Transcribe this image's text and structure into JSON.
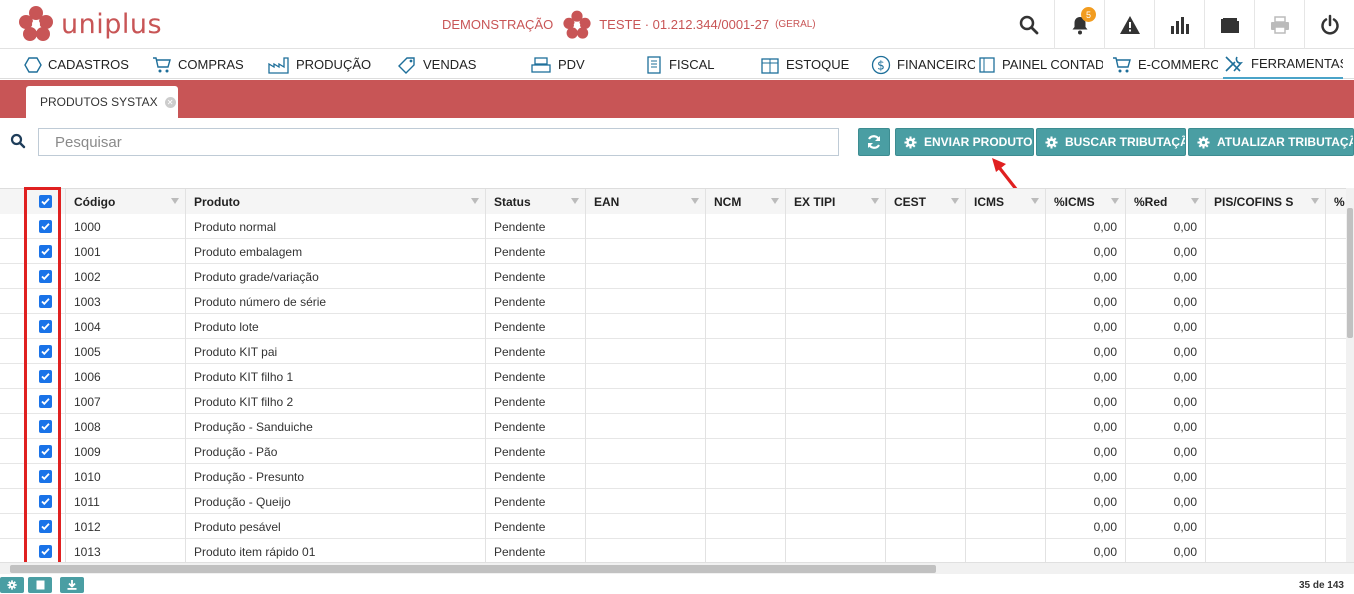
{
  "header": {
    "logo_text": "uniplus",
    "demo_label": "DEMONSTRAÇÃO",
    "company_name": "TESTE · 01.212.344/0001-27",
    "company_scope": "(GERAL)",
    "notification_count": "5",
    "icons": [
      "search-icon",
      "bell-icon",
      "warning-icon",
      "chart-icon",
      "folder-icon",
      "printer-icon",
      "power-icon"
    ]
  },
  "menu": {
    "items": [
      {
        "label": "CADASTROS",
        "icon": "hexagon-icon"
      },
      {
        "label": "COMPRAS",
        "icon": "cart-icon"
      },
      {
        "label": "PRODUÇÃO",
        "icon": "factory-icon"
      },
      {
        "label": "VENDAS",
        "icon": "tag-icon"
      },
      {
        "label": "PDV",
        "icon": "register-icon"
      },
      {
        "label": "FISCAL",
        "icon": "document-icon"
      },
      {
        "label": "ESTOQUE",
        "icon": "box-icon"
      },
      {
        "label": "FINANCEIRO",
        "icon": "dollar-icon"
      },
      {
        "label": "PAINEL CONTADOR",
        "icon": "panel-icon"
      },
      {
        "label": "E-COMMERCE",
        "icon": "cart-icon"
      },
      {
        "label": "FERRAMENTAS",
        "icon": "tools-icon"
      }
    ],
    "active": "FERRAMENTAS"
  },
  "tab": {
    "label": "PRODUTOS SYSTAX"
  },
  "search": {
    "placeholder": "Pesquisar"
  },
  "actions": {
    "send": "ENVIAR PRODUTOS",
    "fetch": "BUSCAR TRIBUTAÇÃO",
    "update": "ATUALIZAR TRIBUTAÇÃO"
  },
  "table": {
    "columns": [
      "Código",
      "Produto",
      "Status",
      "EAN",
      "NCM",
      "EX TIPI",
      "CEST",
      "ICMS",
      "%ICMS",
      "%Red",
      "PIS/COFINS S",
      "%"
    ],
    "rows": [
      {
        "codigo": "1000",
        "produto": "Produto normal",
        "status": "Pendente",
        "icms_pct": "0,00",
        "red": "0,00"
      },
      {
        "codigo": "1001",
        "produto": "Produto embalagem",
        "status": "Pendente",
        "icms_pct": "0,00",
        "red": "0,00"
      },
      {
        "codigo": "1002",
        "produto": "Produto grade/variação",
        "status": "Pendente",
        "icms_pct": "0,00",
        "red": "0,00"
      },
      {
        "codigo": "1003",
        "produto": "Produto número de série",
        "status": "Pendente",
        "icms_pct": "0,00",
        "red": "0,00"
      },
      {
        "codigo": "1004",
        "produto": "Produto lote",
        "status": "Pendente",
        "icms_pct": "0,00",
        "red": "0,00"
      },
      {
        "codigo": "1005",
        "produto": "Produto KIT pai",
        "status": "Pendente",
        "icms_pct": "0,00",
        "red": "0,00"
      },
      {
        "codigo": "1006",
        "produto": "Produto KIT filho 1",
        "status": "Pendente",
        "icms_pct": "0,00",
        "red": "0,00"
      },
      {
        "codigo": "1007",
        "produto": "Produto KIT filho 2",
        "status": "Pendente",
        "icms_pct": "0,00",
        "red": "0,00"
      },
      {
        "codigo": "1008",
        "produto": "Produção - Sanduiche",
        "status": "Pendente",
        "icms_pct": "0,00",
        "red": "0,00"
      },
      {
        "codigo": "1009",
        "produto": "Produção - Pão",
        "status": "Pendente",
        "icms_pct": "0,00",
        "red": "0,00"
      },
      {
        "codigo": "1010",
        "produto": "Produção - Presunto",
        "status": "Pendente",
        "icms_pct": "0,00",
        "red": "0,00"
      },
      {
        "codigo": "1011",
        "produto": "Produção - Queijo",
        "status": "Pendente",
        "icms_pct": "0,00",
        "red": "0,00"
      },
      {
        "codigo": "1012",
        "produto": "Produto pesável",
        "status": "Pendente",
        "icms_pct": "0,00",
        "red": "0,00"
      },
      {
        "codigo": "1013",
        "produto": "Produto item rápido 01",
        "status": "Pendente",
        "icms_pct": "0,00",
        "red": "0,00"
      }
    ]
  },
  "footer": {
    "pager": "35 de 143"
  },
  "colors": {
    "brand": "#c85556",
    "button": "#4a9ea3",
    "checkbox": "#1a73e8",
    "highlight": "#e02020"
  }
}
